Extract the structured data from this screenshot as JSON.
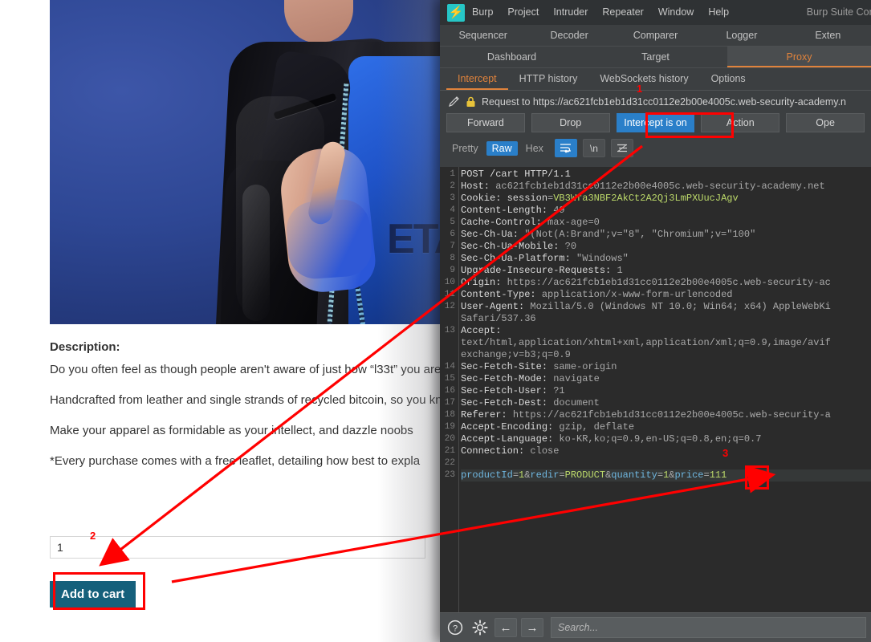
{
  "webpage": {
    "description_label": "Description:",
    "paragraphs": [
      "Do you often feel as though people aren't aware of just how “l33t” you are? Do you find yourself struggling to make your advanced “l33t-ness”? If either of these things are at the top of your p",
      "Handcrafted from leather and single strands of recycled bitcoin, so you know this jacket is far superior to anything currently available on the high st guarantee you'll be at least 18% cooler when donning your “l33t” leat you can channel the original elite every time you rock your Lightweigh",
      "Make your apparel as formidable as your intellect, and dazzle noobs",
      "*Every purchase comes with a free leaflet, detailing how best to expla"
    ],
    "quantity_value": "1",
    "quantity_placeholder": "1",
    "add_to_cart_label": "Add to cart",
    "tshirt_text": "ETA"
  },
  "burp": {
    "window_title": "Burp Suite Com",
    "logo_glyph": "⚡",
    "menu": [
      "Burp",
      "Project",
      "Intruder",
      "Repeater",
      "Window",
      "Help"
    ],
    "tabs_row1": [
      "Sequencer",
      "Decoder",
      "Comparer",
      "Logger",
      "Exten"
    ],
    "tabs_row2": [
      "Dashboard",
      "Target",
      "Proxy"
    ],
    "tabs_row2_selected": "Proxy",
    "subtabs": [
      "Intercept",
      "HTTP history",
      "WebSockets history",
      "Options"
    ],
    "subtabs_selected": "Intercept",
    "request_line": "Request to https://ac621fcb1eb1d31cc0112e2b00e4005c.web-security-academy.n",
    "buttons": [
      "Forward",
      "Drop",
      "Intercept is on",
      "Action",
      "Ope"
    ],
    "intercept_button_label": "Intercept is on",
    "intercept_on": true,
    "format_tabs": [
      "Pretty",
      "Raw",
      "Hex"
    ],
    "format_selected": "Raw",
    "editor_icons": [
      "wrap-lines-icon",
      "newline-icon",
      "format-icon"
    ],
    "search_placeholder": "Search...",
    "accent_color": "#e0833c",
    "highlight_color": "#2a7fc9",
    "annotation_color": "#ff0000"
  },
  "request": {
    "lines": [
      {
        "n": "1",
        "segments": [
          {
            "t": "POST /cart HTTP/1.1",
            "c": "hdr"
          }
        ]
      },
      {
        "n": "2",
        "segments": [
          {
            "t": "Host: ",
            "c": "hdr"
          },
          {
            "t": "ac621fcb1eb1d31cc0112e2b00e4005c.web-security-academy.net",
            "c": "val"
          }
        ]
      },
      {
        "n": "3",
        "segments": [
          {
            "t": "Cookie: ",
            "c": "hdr"
          },
          {
            "t": "session",
            "c": "hdr"
          },
          {
            "t": "=",
            "c": "val"
          },
          {
            "t": "VB3Wfa3NBF2AkCt2A2Qj3LmPXUucJAgv",
            "c": "grn"
          }
        ]
      },
      {
        "n": "4",
        "segments": [
          {
            "t": "Content-Length: ",
            "c": "hdr"
          },
          {
            "t": "49",
            "c": "val"
          }
        ]
      },
      {
        "n": "5",
        "segments": [
          {
            "t": "Cache-Control: ",
            "c": "hdr"
          },
          {
            "t": "max-age=0",
            "c": "val"
          }
        ]
      },
      {
        "n": "6",
        "segments": [
          {
            "t": "Sec-Ch-Ua: ",
            "c": "hdr"
          },
          {
            "t": "\"(Not(A:Brand\";v=\"8\", \"Chromium\";v=\"100\"",
            "c": "val"
          }
        ]
      },
      {
        "n": "7",
        "segments": [
          {
            "t": "Sec-Ch-Ua-Mobile: ",
            "c": "hdr"
          },
          {
            "t": "?0",
            "c": "val"
          }
        ]
      },
      {
        "n": "8",
        "segments": [
          {
            "t": "Sec-Ch-Ua-Platform: ",
            "c": "hdr"
          },
          {
            "t": "\"Windows\"",
            "c": "val"
          }
        ]
      },
      {
        "n": "9",
        "segments": [
          {
            "t": "Upgrade-Insecure-Requests: ",
            "c": "hdr"
          },
          {
            "t": "1",
            "c": "val"
          }
        ]
      },
      {
        "n": "10",
        "segments": [
          {
            "t": "Origin: ",
            "c": "hdr"
          },
          {
            "t": "https://ac621fcb1eb1d31cc0112e2b00e4005c.web-security-ac",
            "c": "val"
          }
        ]
      },
      {
        "n": "11",
        "segments": [
          {
            "t": "Content-Type: ",
            "c": "hdr"
          },
          {
            "t": "application/x-www-form-urlencoded",
            "c": "val"
          }
        ]
      },
      {
        "n": "12",
        "segments": [
          {
            "t": "User-Agent: ",
            "c": "hdr"
          },
          {
            "t": "Mozilla/5.0 (Windows NT 10.0; Win64; x64) AppleWebKi",
            "c": "val"
          }
        ]
      },
      {
        "n": "",
        "segments": [
          {
            "t": "Safari/537.36",
            "c": "val"
          }
        ]
      },
      {
        "n": "13",
        "segments": [
          {
            "t": "Accept:",
            "c": "hdr"
          }
        ]
      },
      {
        "n": "",
        "segments": [
          {
            "t": "text/html,application/xhtml+xml,application/xml;q=0.9,image/avif",
            "c": "val"
          }
        ]
      },
      {
        "n": "",
        "segments": [
          {
            "t": "exchange;v=b3;q=0.9",
            "c": "val"
          }
        ]
      },
      {
        "n": "14",
        "segments": [
          {
            "t": "Sec-Fetch-Site: ",
            "c": "hdr"
          },
          {
            "t": "same-origin",
            "c": "val"
          }
        ]
      },
      {
        "n": "15",
        "segments": [
          {
            "t": "Sec-Fetch-Mode: ",
            "c": "hdr"
          },
          {
            "t": "navigate",
            "c": "val"
          }
        ]
      },
      {
        "n": "16",
        "segments": [
          {
            "t": "Sec-Fetch-User: ",
            "c": "hdr"
          },
          {
            "t": "?1",
            "c": "val"
          }
        ]
      },
      {
        "n": "17",
        "segments": [
          {
            "t": "Sec-Fetch-Dest: ",
            "c": "hdr"
          },
          {
            "t": "document",
            "c": "val"
          }
        ]
      },
      {
        "n": "18",
        "segments": [
          {
            "t": "Referer: ",
            "c": "hdr"
          },
          {
            "t": "https://ac621fcb1eb1d31cc0112e2b00e4005c.web-security-a",
            "c": "val"
          }
        ]
      },
      {
        "n": "19",
        "segments": [
          {
            "t": "Accept-Encoding: ",
            "c": "hdr"
          },
          {
            "t": "gzip, deflate",
            "c": "val"
          }
        ]
      },
      {
        "n": "20",
        "segments": [
          {
            "t": "Accept-Language: ",
            "c": "hdr"
          },
          {
            "t": "ko-KR,ko;q=0.9,en-US;q=0.8,en;q=0.7",
            "c": "val"
          }
        ]
      },
      {
        "n": "21",
        "segments": [
          {
            "t": "Connection: ",
            "c": "hdr"
          },
          {
            "t": "close",
            "c": "val"
          }
        ]
      },
      {
        "n": "22",
        "segments": []
      },
      {
        "n": "23",
        "body": true,
        "segments": [
          {
            "t": "productId",
            "c": "blu"
          },
          {
            "t": "=",
            "c": "val"
          },
          {
            "t": "1",
            "c": "num"
          },
          {
            "t": "&",
            "c": "val"
          },
          {
            "t": "redir",
            "c": "blu"
          },
          {
            "t": "=",
            "c": "val"
          },
          {
            "t": "PRODUCT",
            "c": "grn"
          },
          {
            "t": "&",
            "c": "val"
          },
          {
            "t": "quantity",
            "c": "blu"
          },
          {
            "t": "=",
            "c": "val"
          },
          {
            "t": "1",
            "c": "num"
          },
          {
            "t": "&",
            "c": "val"
          },
          {
            "t": "price",
            "c": "blu"
          },
          {
            "t": "=",
            "c": "val"
          },
          {
            "t": "111",
            "c": "num"
          }
        ]
      }
    ],
    "body_params": {
      "productId": "1",
      "redir": "PRODUCT",
      "quantity": "1",
      "price": "111"
    }
  },
  "annotations": {
    "markers": [
      "1",
      "2",
      "3"
    ],
    "marker_1": "1",
    "marker_2": "2",
    "marker_3": "3",
    "color": "#ff0000"
  }
}
